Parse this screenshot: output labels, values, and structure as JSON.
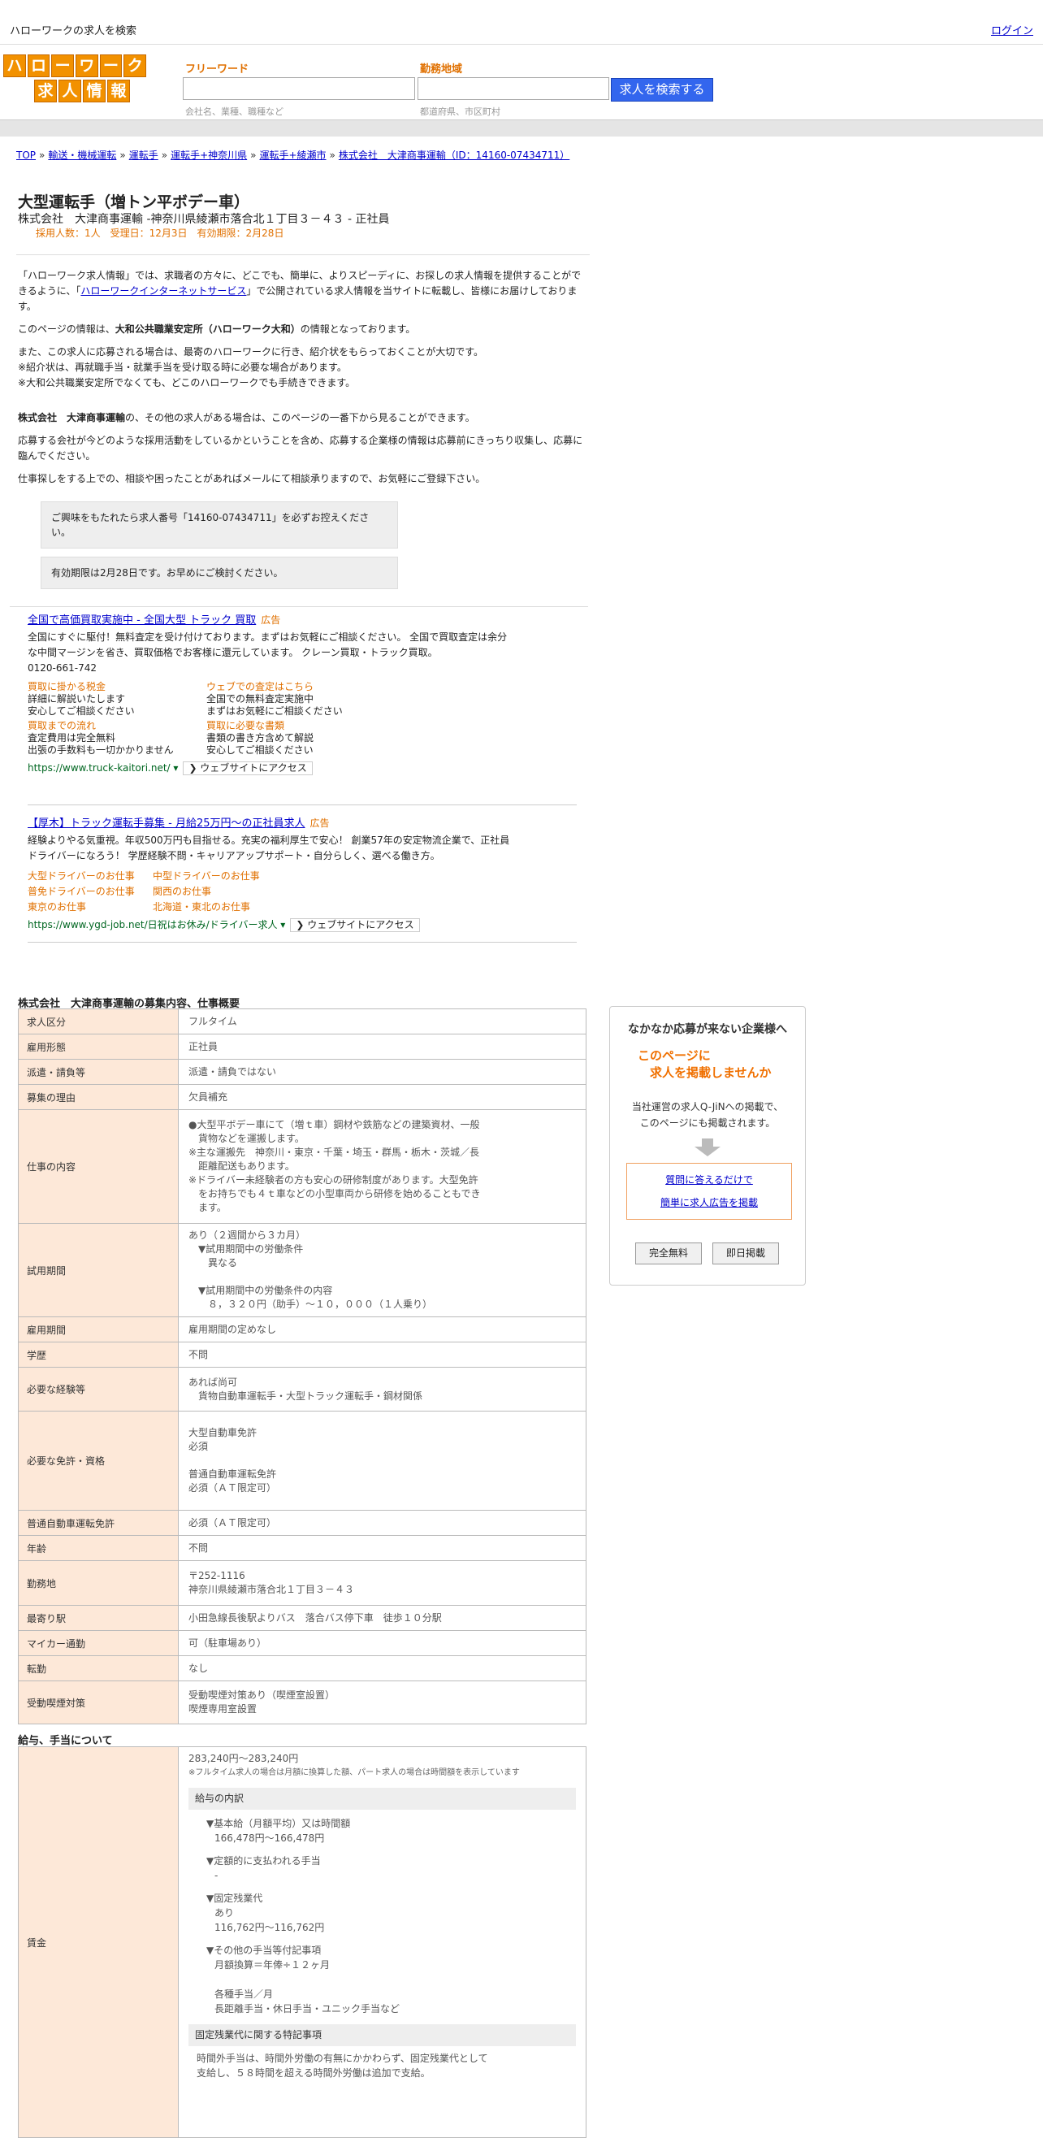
{
  "topbar": {
    "site_title": "ハローワークの求人を検索",
    "login": "ログイン"
  },
  "logo": {
    "row1": [
      "ハ",
      "ロ",
      "ー",
      "ワ",
      "ー",
      "ク"
    ],
    "row2": [
      "求",
      "人",
      "情",
      "報"
    ]
  },
  "search": {
    "freeword_label": "フリーワード",
    "freeword_hint": "会社名、業種、職種など",
    "area_label": "勤務地域",
    "area_hint": "都道府県、市区町村",
    "button": "求人を検索する"
  },
  "breadcrumb": [
    "TOP",
    "輸送・機械運転",
    "運転手",
    "運転手+神奈川県",
    "運転手+綾瀬市",
    "株式会社　大津商事運輸（ID：14160-07434711）"
  ],
  "job": {
    "title": "大型運転手（増トン平ボデー車）",
    "company_line": "株式会社　大津商事運輸 -神奈川県綾瀬市落合北１丁目３－４３ - 正社員",
    "meta": "採用人数：1人　受理日：12月3日　有効期限：2月28日"
  },
  "intro": {
    "p1_pre": "「ハローワーク求人情報」では、求職者の方々に、どこでも、簡単に、よりスピーディに、お探しの求人情報を提供することができるように、「",
    "p1_link": "ハローワークインターネットサービス",
    "p1_post": "」で公開されている求人情報を当サイトに転載し、皆様にお届けしております。",
    "p2_pre": "このページの情報は、",
    "p2_bold": "大和公共職業安定所（ハローワーク大和）",
    "p2_post": "の情報となっております。",
    "p3_l1": "また、この求人に応募される場合は、最寄のハローワークに行き、紹介状をもらっておくことが大切です。",
    "p3_l2": "※紹介状は、再就職手当・就業手当を受け取る時に必要な場合があります。",
    "p3_l3": "※大和公共職業安定所でなくても、どこのハローワークでも手続きできます。",
    "p4_bold": "株式会社　大津商事運輸",
    "p4_post": "の、その他の求人がある場合は、このページの一番下から見ることができます。",
    "p5": "応募する会社が今どのような採用活動をしているかということを含め、応募する企業様の情報は応募前にきっちり収集し、応募に臨んでください。",
    "p6": "仕事探しをする上での、相談や困ったことがあればメールにて相談承りますので、お気軽にご登録下さい。"
  },
  "notices": {
    "n1": "ご興味をもたれたら求人番号「14160-07434711」を必ずお控えください。",
    "n2": "有効期限は2月28日です。お早めにご検討ください。"
  },
  "ad1": {
    "title": "全国で高価買取実施中 - 全国大型 トラック 買取",
    "tag": "広告",
    "body": "全国にすぐに駆付！無料査定を受け付けております。まずはお気軽にご相談ください。 全国で買取査定は余分な中間マージンを省き、買取価格でお客様に還元しています。 クレーン買取・トラック買取。",
    "phone": "0120-661-742",
    "links": [
      {
        "title": "買取に掛かる税金",
        "l1": "詳細に解説いたします",
        "l2": "安心してご相談ください"
      },
      {
        "title": "ウェブでの査定はこちら",
        "l1": "全国での無料査定実施中",
        "l2": "まずはお気軽にご相談ください"
      },
      {
        "title": "買取までの流れ",
        "l1": "査定費用は完全無料",
        "l2": "出張の手数料も一切かかりません"
      },
      {
        "title": "買取に必要な書類",
        "l1": "書類の書き方含めて解説",
        "l2": "安心してご相談ください"
      }
    ],
    "url": "https://www.truck-kaitori.net/",
    "visit": "❯ ウェブサイトにアクセス"
  },
  "ad2": {
    "title": "【厚木】トラック運転手募集 - 月給25万円～の正社員求人",
    "tag": "広告",
    "body": "経験よりやる気重視。年収500万円も目指せる。充実の福利厚生で安心！ 創業57年の安定物流企業で、正社員ドライバーになろう！ 学歴経験不問・キャリアアップサポート・自分らしく、選べる働き方。",
    "links": [
      "大型ドライバーのお仕事",
      "中型ドライバーのお仕事",
      "普免ドライバーのお仕事",
      "関西のお仕事",
      "東京のお仕事",
      "北海道・東北のお仕事"
    ],
    "url": "https://www.ygd-job.net/日祝はお休み/ドライバー求人",
    "visit": "❯ ウェブサイトにアクセス"
  },
  "recruit": {
    "title": "株式会社　大津商事運輸の募集内容、仕事概要",
    "rows": [
      {
        "label": "求人区分",
        "value": "フルタイム"
      },
      {
        "label": "雇用形態",
        "value": "正社員"
      },
      {
        "label": "派遣・請負等",
        "value": "派遣・請負ではない"
      },
      {
        "label": "募集の理由",
        "value": "欠員補充"
      },
      {
        "label": "仕事の内容",
        "value": "●大型平ボデー車にて（増ｔ車）鋼材や鉄筋などの建築資材、一般\n　貨物などを運搬します。\n※主な運搬先　神奈川・東京・千葉・埼玉・群馬・栃木・茨城／長\n　距離配送もあります。\n※ドライバー未経験者の方も安心の研修制度があります。大型免許\n　をお持ちでも４ｔ車などの小型車両から研修を始めることもでき\n　ます。"
      },
      {
        "label": "試用期間",
        "value": "あり（２週間から３カ月）\n　▼試用期間中の労働条件\n　　異なる\n\n　▼試用期間中の労働条件の内容\n　　８，３２０円（助手）～１０，０００（１人乗り）"
      },
      {
        "label": "雇用期間",
        "value": "雇用期間の定めなし"
      },
      {
        "label": "学歴",
        "value": "不問"
      },
      {
        "label": "必要な経験等",
        "value": "あれば尚可\n　貨物自動車運転手・大型トラック運転手・鋼材関係"
      },
      {
        "label": "必要な免許・資格",
        "value": "大型自動車免許\n必須\n\n普通自動車運転免許\n必須（ＡＴ限定可）"
      },
      {
        "label": "普通自動車運転免許",
        "value": "必須（ＡＴ限定可）"
      },
      {
        "label": "年齢",
        "value": "不問"
      },
      {
        "label": "勤務地",
        "value": "〒252-1116\n神奈川県綾瀬市落合北１丁目３－４３"
      },
      {
        "label": "最寄り駅",
        "value": "小田急線長後駅よりバス　落合バス停下車　徒歩１０分駅"
      },
      {
        "label": "マイカー通勤",
        "value": "可（駐車場あり）"
      },
      {
        "label": "転勤",
        "value": "なし"
      },
      {
        "label": "受動喫煙対策",
        "value": "受動喫煙対策あり（喫煙室設置）\n喫煙専用室設置"
      }
    ]
  },
  "salary": {
    "title": "給与、手当について",
    "label": "賃金",
    "range": "283,240円〜283,240円",
    "note": "※フルタイム求人の場合は月額に換算した額、パート求人の場合は時間額を表示しています",
    "breakdown_head": "給与の内訳",
    "items": [
      {
        "head": "▼基本給（月額平均）又は時間額",
        "val": "166,478円〜166,478円"
      },
      {
        "head": "▼定額的に支払われる手当",
        "val": "-"
      },
      {
        "head": "▼固定残業代",
        "val": "あり\n116,762円〜116,762円"
      },
      {
        "head": "▼その他の手当等付記事項",
        "val": "月額換算＝年俸÷１２ヶ月\n\n各種手当／月\n長距離手当・休日手当・ユニック手当など"
      }
    ],
    "fixed_ot_head": "固定残業代に関する特記事項",
    "fixed_ot_text": "時間外手当は、時間外労働の有無にかかわらず、固定残業代として\n支給し、５８時間を超える時間外労働は追加で支給。"
  },
  "sidebox": {
    "t1": "なかなか応募が来ない企業様へ",
    "t2_l1": "このページに",
    "t2_l2": "求人を掲載しませんか",
    "t3_l1": "当社運営の求人Q-JiNへの掲載で、",
    "t3_l2": "このページにも掲載されます。",
    "cta_l1": "質問に答えるだけで",
    "cta_l2": "簡単に求人広告を掲載",
    "btn1": "完全無料",
    "btn2": "即日掲載"
  }
}
